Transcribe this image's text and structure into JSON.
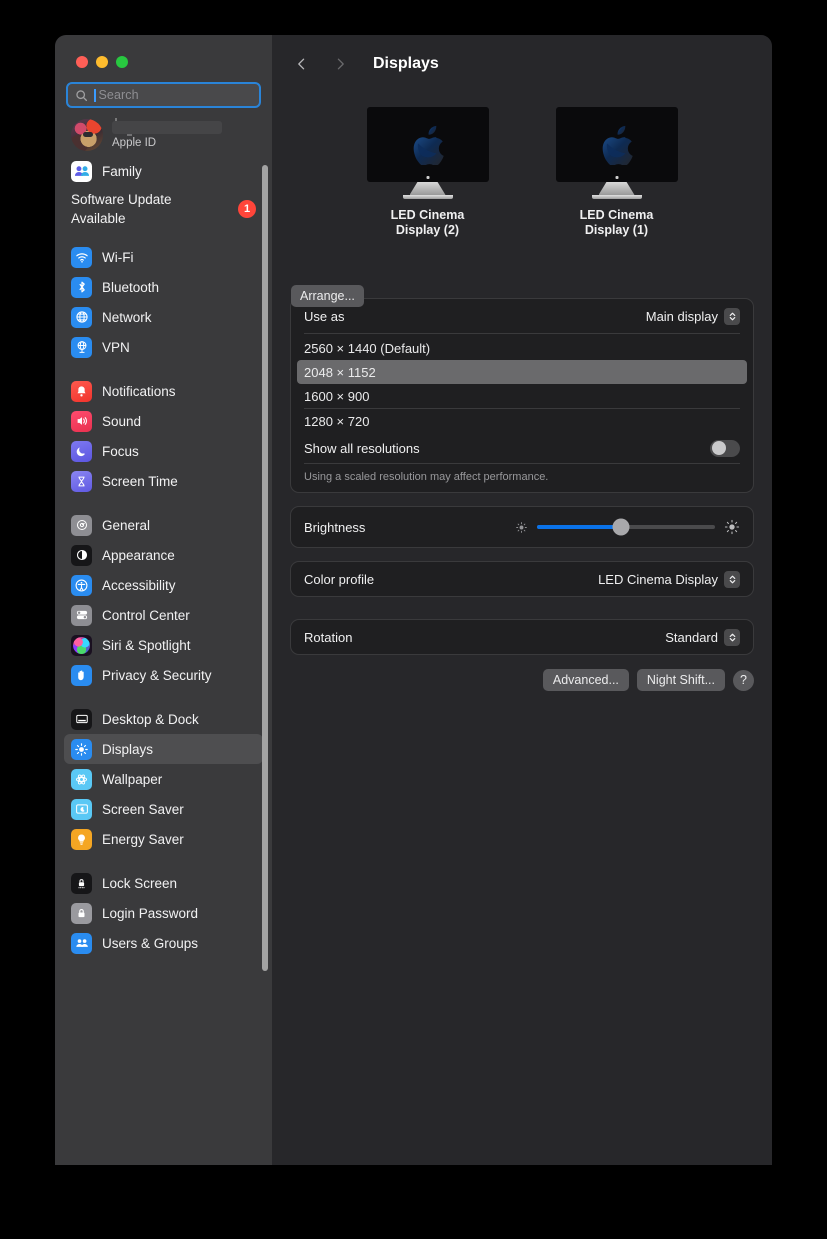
{
  "window": {
    "traffic_lights": [
      "close",
      "minimize",
      "zoom"
    ],
    "colors": {
      "close": "#ff5f57",
      "minimize": "#febc2e",
      "zoom": "#28c840",
      "accent": "#0a72e8",
      "badge": "#ff453a",
      "focus_ring": "#2a84d8"
    }
  },
  "search": {
    "placeholder": "Search",
    "value": ""
  },
  "account": {
    "name": "",
    "subtitle": "Apple ID"
  },
  "software_update": {
    "label": "Software Update Available",
    "badge": "1"
  },
  "sidebar": {
    "groups": [
      {
        "items": [
          {
            "label": "Family",
            "icon": "family-icon"
          }
        ]
      },
      {
        "items": [
          {
            "label": "Wi-Fi",
            "icon": "wifi-icon"
          },
          {
            "label": "Bluetooth",
            "icon": "bluetooth-icon"
          },
          {
            "label": "Network",
            "icon": "network-icon"
          },
          {
            "label": "VPN",
            "icon": "vpn-icon"
          }
        ]
      },
      {
        "items": [
          {
            "label": "Notifications",
            "icon": "bell-icon"
          },
          {
            "label": "Sound",
            "icon": "speaker-icon"
          },
          {
            "label": "Focus",
            "icon": "moon-icon"
          },
          {
            "label": "Screen Time",
            "icon": "hourglass-icon"
          }
        ]
      },
      {
        "items": [
          {
            "label": "General",
            "icon": "gear-icon"
          },
          {
            "label": "Appearance",
            "icon": "contrast-icon"
          },
          {
            "label": "Accessibility",
            "icon": "accessibility-icon"
          },
          {
            "label": "Control Center",
            "icon": "sliders-icon"
          },
          {
            "label": "Siri & Spotlight",
            "icon": "siri-icon"
          },
          {
            "label": "Privacy & Security",
            "icon": "hand-icon"
          }
        ]
      },
      {
        "items": [
          {
            "label": "Desktop & Dock",
            "icon": "desktop-icon"
          },
          {
            "label": "Displays",
            "icon": "brightness-icon",
            "selected": true
          },
          {
            "label": "Wallpaper",
            "icon": "wallpaper-icon"
          },
          {
            "label": "Screen Saver",
            "icon": "screensaver-icon"
          },
          {
            "label": "Energy Saver",
            "icon": "bulb-icon"
          }
        ]
      },
      {
        "items": [
          {
            "label": "Lock Screen",
            "icon": "lock-screen-icon"
          },
          {
            "label": "Login Password",
            "icon": "padlock-icon"
          },
          {
            "label": "Users & Groups",
            "icon": "users-icon"
          }
        ]
      }
    ]
  },
  "toolbar": {
    "back": "back-chevron",
    "forward": "forward-chevron",
    "title": "Displays"
  },
  "displays": {
    "arrange_label": "Arrange...",
    "items": [
      {
        "name_line1": "LED Cinema",
        "name_line2": "Display (2)",
        "selected": false
      },
      {
        "name_line1": "LED Cinema",
        "name_line2": "Display (1)",
        "selected": true
      }
    ]
  },
  "settings": {
    "use_as": {
      "label": "Use as",
      "value": "Main display"
    },
    "resolutions": [
      {
        "label": "2560 × 1440 (Default)",
        "selected": false
      },
      {
        "label": "2048 × 1152",
        "selected": true
      },
      {
        "label": "1600 × 900",
        "selected": false
      },
      {
        "label": "1280 × 720",
        "selected": false
      }
    ],
    "show_all": {
      "label": "Show all resolutions",
      "enabled": false
    },
    "note": "Using a scaled resolution may affect performance.",
    "brightness": {
      "label": "Brightness",
      "value": 47
    },
    "color_profile": {
      "label": "Color profile",
      "value": "LED Cinema Display"
    },
    "rotation": {
      "label": "Rotation",
      "value": "Standard"
    }
  },
  "actions": {
    "advanced": "Advanced...",
    "night_shift": "Night Shift...",
    "help": "?"
  }
}
